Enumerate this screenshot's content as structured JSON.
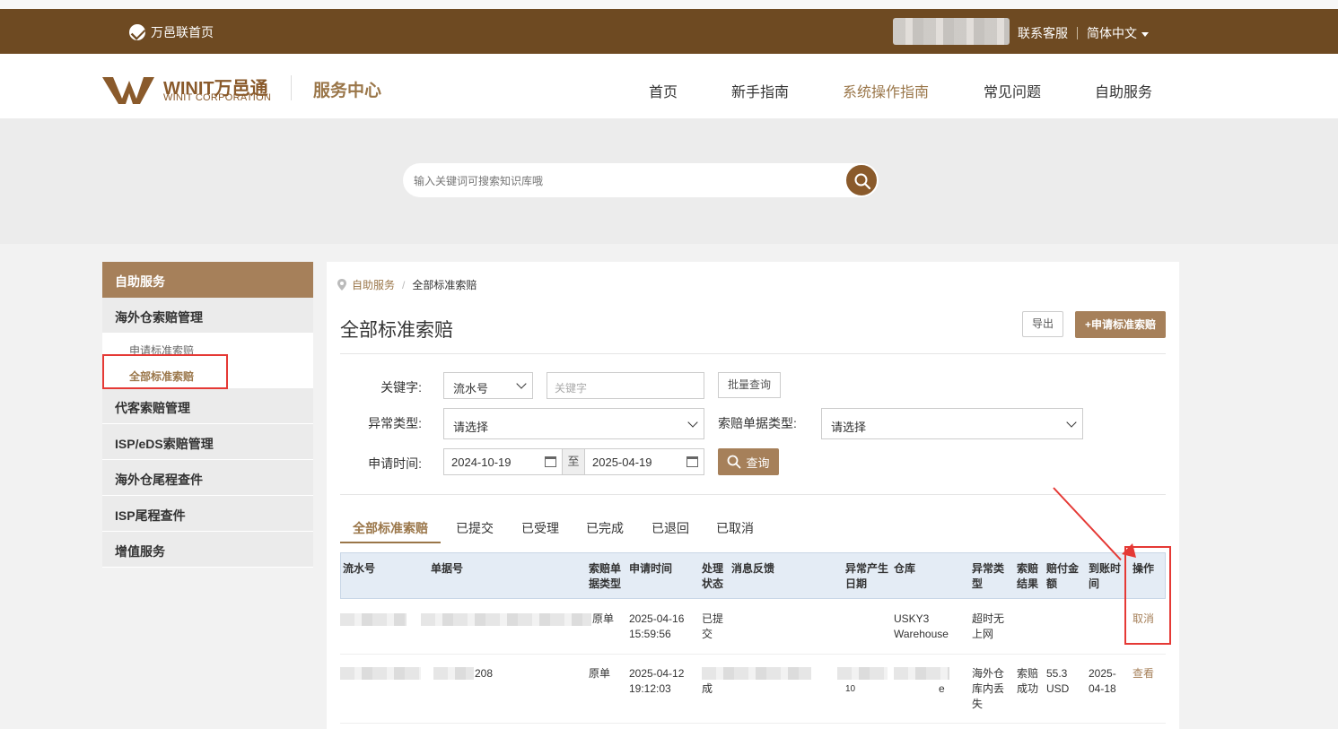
{
  "topbar": {
    "home": "万邑联首页",
    "support": "联系客服",
    "language": "简体中文"
  },
  "header": {
    "logo_text": "WINIT万邑通",
    "logo_sub": "WINIT CORPORATION",
    "service_center": "服务中心",
    "nav": [
      "首页",
      "新手指南",
      "系统操作指南",
      "常见问题",
      "自助服务"
    ]
  },
  "search": {
    "placeholder": "输入关键词可搜索知识库哦"
  },
  "sidebar": {
    "head": "自助服务",
    "groups": [
      "海外仓索赔管理",
      "代客索赔管理",
      "ISP/eDS索赔管理",
      "海外仓尾程查件",
      "ISP尾程查件",
      "增值服务"
    ],
    "sub_items": [
      "申请标准索赔",
      "全部标准索赔"
    ]
  },
  "main": {
    "breadcrumb": {
      "parent": "自助服务",
      "current": "全部标准索赔"
    },
    "title": "全部标准索赔",
    "export_label": "导出",
    "apply_label": "+申请标准索赔",
    "filters": {
      "keyword_label": "关键字:",
      "keyword_type": "流水号",
      "keyword_placeholder": "关键字",
      "batch_label": "批量查询",
      "exception_label": "异常类型:",
      "exception_value": "请选择",
      "claim_type_label": "索赔单据类型:",
      "claim_type_value": "请选择",
      "date_label": "申请时间:",
      "date_from": "2024-10-19",
      "date_to_sep": "至",
      "date_to": "2025-04-19",
      "query_label": "查询"
    },
    "tabs": [
      "全部标准索赔",
      "已提交",
      "已受理",
      "已完成",
      "已退回",
      "已取消"
    ],
    "table": {
      "headers": [
        "流水号",
        "单据号",
        "索赔单据类型",
        "申请时间",
        "处理状态",
        "消息反馈",
        "异常产生日期",
        "仓库",
        "异常类型",
        "索赔结果",
        "赔付金额",
        "到账时间",
        "操作"
      ],
      "rows": [
        {
          "doc_no": "",
          "doc_type": "原单",
          "time": "2025-04-16 15:59:56",
          "status": "已提交",
          "exc_date": "",
          "warehouse": "USKY3 Warehouse",
          "exc_type": "超时无上网",
          "result": "",
          "amount": "",
          "arrive": "",
          "action": "取消"
        },
        {
          "doc_no": "208",
          "doc_type": "原单",
          "time": "2025-04-12 19:12:03",
          "status": "成",
          "exc_date": "10",
          "warehouse": "e",
          "exc_type": "海外仓库内丢失",
          "result": "索赔成功",
          "amount": "55.3 USD",
          "arrive": "2025-04-18",
          "action": "查看"
        }
      ]
    }
  }
}
